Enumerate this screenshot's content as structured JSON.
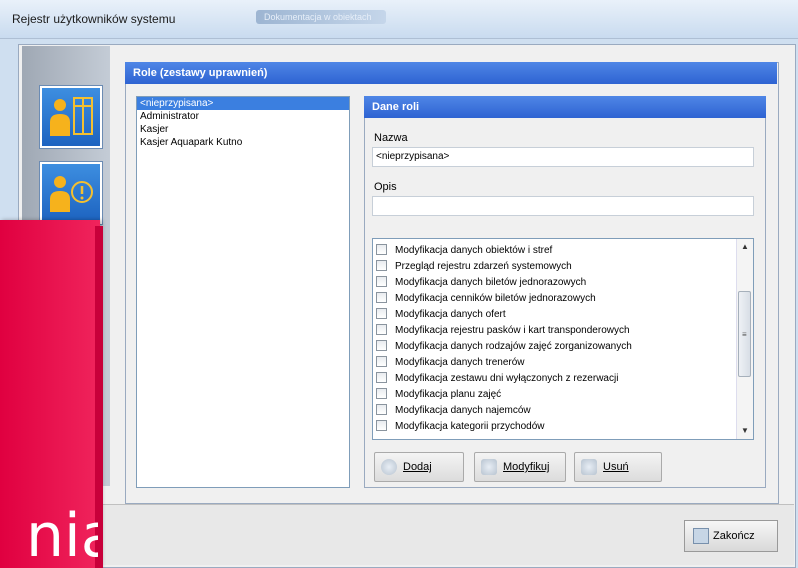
{
  "window": {
    "title": "Rejestr użytkowników systemu",
    "blurred_tab": "Dokumentacja w obiektach"
  },
  "panel": {
    "title": "Role (zestawy uprawnień)"
  },
  "roles": [
    "<nieprzypisana>",
    "Administrator",
    "Kasjer",
    "Kasjer Aquapark Kutno"
  ],
  "selected_role_index": 0,
  "details": {
    "title": "Dane roli",
    "name_label": "Nazwa",
    "name_value": "<nieprzypisana>",
    "desc_label": "Opis",
    "desc_value": ""
  },
  "permissions": [
    "Modyfikacja danych obiektów i stref",
    "Przegląd rejestru zdarzeń systemowych",
    "Modyfikacja danych biletów jednorazowych",
    "Modyfikacja cenników biletów jednorazowych",
    "Modyfikacja danych ofert",
    "Modyfikacja rejestru pasków i kart transponderowych",
    "Modyfikacja danych rodzajów zajęć zorganizowanych",
    "Modyfikacja danych trenerów",
    "Modyfikacja zestawu dni wyłączonych z rezerwacji",
    "Modyfikacja planu zajęć",
    "Modyfikacja danych najemców",
    "Modyfikacja kategorii przychodów"
  ],
  "buttons": {
    "add": "Dodaj",
    "modify": "Modyfikuj",
    "remove": "Usuń",
    "close": "Zakończ"
  },
  "overlay": {
    "text": "nia",
    "color": "#e8004a"
  },
  "icons": {
    "tool1": "user-table-icon",
    "tool2": "user-alert-icon"
  }
}
